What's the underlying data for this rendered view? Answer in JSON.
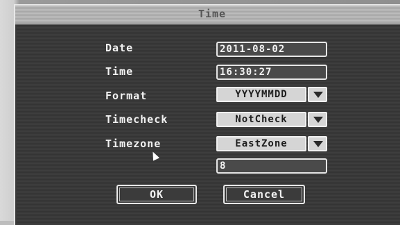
{
  "dialog": {
    "title": "Time"
  },
  "form": {
    "date_label": "Date",
    "date_value": "2011-08-02",
    "time_label": "Time",
    "time_value": "16:30:27",
    "format_label": "Format",
    "format_value": "YYYYMMDD",
    "timecheck_label": "Timecheck",
    "timecheck_value": "NotCheck",
    "timezone_label": "Timezone",
    "timezone_value": "EastZone",
    "timezone_offset": "8"
  },
  "buttons": {
    "ok_label": "OK",
    "cancel_label": "Cancel"
  },
  "icons": {
    "dropdown": "chevron-down-icon",
    "pointer": "mouse-pointer-icon"
  },
  "colors": {
    "panel": "#3a3a3a",
    "titlebar": "#b4b4b4",
    "text": "#f2f2f2",
    "select_bg": "#d5d5d5"
  }
}
